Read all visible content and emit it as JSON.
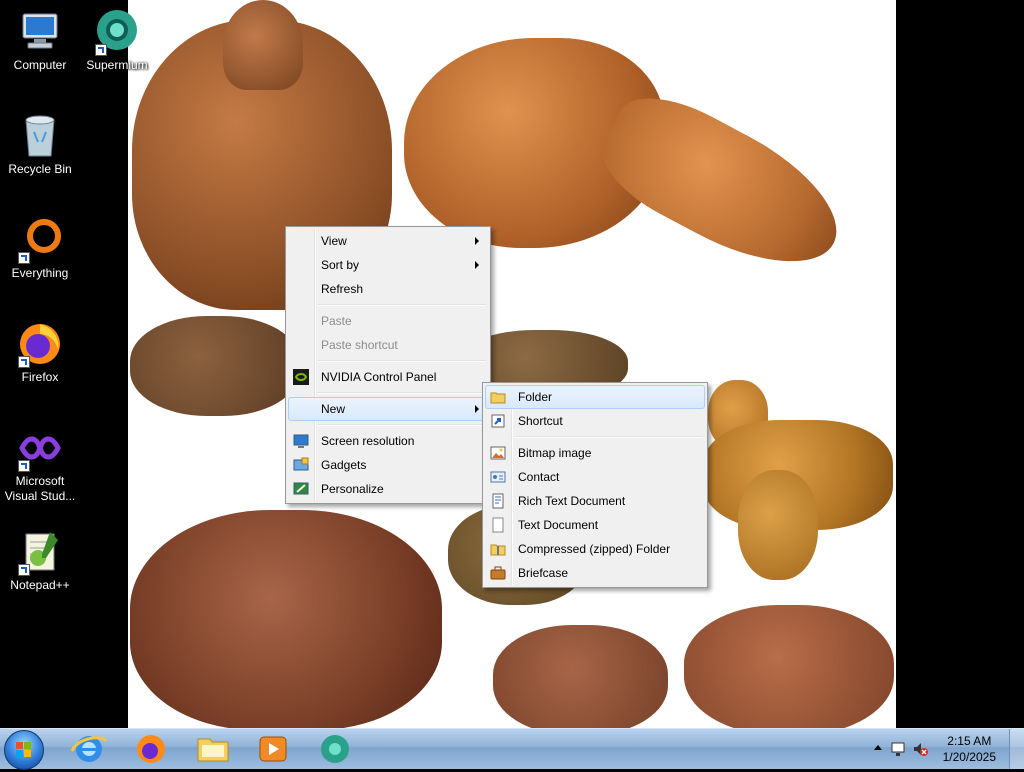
{
  "desktop": {
    "icons": [
      {
        "label": "Computer",
        "icon": "computer-icon"
      },
      {
        "label": "Supermium",
        "icon": "supermium-icon"
      },
      {
        "label": "Recycle Bin",
        "icon": "recycle-bin-icon"
      },
      {
        "label": "Everything",
        "icon": "everything-icon"
      },
      {
        "label": "Firefox",
        "icon": "firefox-icon"
      },
      {
        "label": "Microsoft Visual Stud...",
        "icon": "visual-studio-icon"
      },
      {
        "label": "Notepad++",
        "icon": "notepadpp-icon"
      }
    ]
  },
  "context_menu": {
    "items": {
      "view": "View",
      "sort_by": "Sort by",
      "refresh": "Refresh",
      "paste": "Paste",
      "paste_shortcut": "Paste shortcut",
      "nvidia": "NVIDIA Control Panel",
      "new": "New",
      "screen_resolution": "Screen resolution",
      "gadgets": "Gadgets",
      "personalize": "Personalize"
    }
  },
  "new_submenu": {
    "items": {
      "folder": "Folder",
      "shortcut": "Shortcut",
      "bitmap": "Bitmap image",
      "contact": "Contact",
      "rtf": "Rich Text Document",
      "text": "Text Document",
      "zip": "Compressed (zipped) Folder",
      "briefcase": "Briefcase"
    }
  },
  "taskbar": {
    "pinned": [
      "start-orb",
      "internet-explorer-icon",
      "firefox-icon",
      "file-explorer-icon",
      "media-player-icon",
      "supermium-icon"
    ],
    "clock": {
      "time": "2:15 AM",
      "date": "1/20/2025"
    }
  },
  "colors": {
    "menu_bg": "#f0f0f0",
    "menu_highlight": "#d9e9fb",
    "taskbar": "#9dbde0",
    "wallpaper_subject": "#9a5a2c"
  }
}
